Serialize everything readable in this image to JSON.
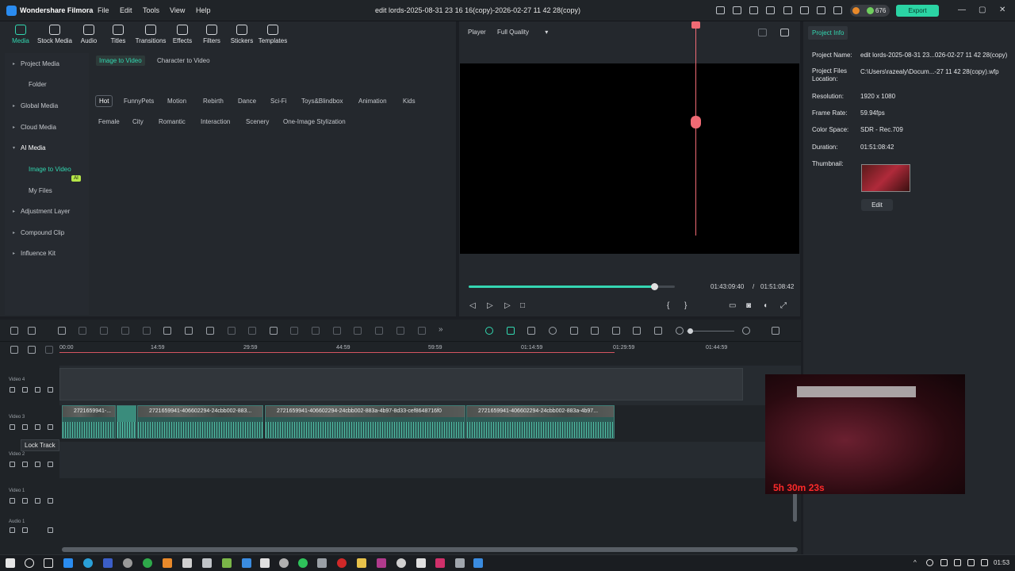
{
  "titlebar": {
    "app_name": "Wondershare Filmora",
    "menu": [
      "File",
      "Edit",
      "Tools",
      "View",
      "Help"
    ],
    "doc_title": "edit lords-2025-08-31 23 16 16(copy)-2026-02-27 11 42 28(copy)",
    "credits": "676",
    "export_label": "Export"
  },
  "toolbar": {
    "items": [
      "Media",
      "Stock Media",
      "Audio",
      "Titles",
      "Transitions",
      "Effects",
      "Filters",
      "Stickers",
      "Templates"
    ]
  },
  "sidebar": {
    "items": [
      "Project Media",
      "Folder",
      "Global Media",
      "Cloud Media",
      "AI Media",
      "Image to Video",
      "My Files",
      "Adjustment Layer",
      "Compound Clip",
      "Influence Kit"
    ],
    "ai_badge": "AI"
  },
  "media": {
    "tabs": [
      "Image to Video",
      "Character to Video"
    ],
    "chips_row1": [
      "Hot",
      "FunnyPets",
      "Motion",
      "Rebirth",
      "Dance",
      "Sci-Fi",
      "Toys&Blindbox",
      "Animation",
      "Kids"
    ],
    "chips_row2": [
      "Female",
      "City",
      "Romantic",
      "Interaction",
      "Scenery",
      "One-Image Stylization"
    ]
  },
  "player": {
    "label": "Player",
    "quality": "Full Quality",
    "current_time": "01:43:09:40",
    "separator": "/",
    "total_time": "01:51:08:42",
    "progress": 0.9
  },
  "project_info": {
    "tab": "Project Info",
    "rows": [
      {
        "k": "Project Name:",
        "v": "edit lords-2025-08-31 23...026-02-27 11 42 28(copy)"
      },
      {
        "k": "Project Files Location:",
        "v": "C:\\Users\\razealy\\Docum...-27 11 42 28(copy).wfp"
      },
      {
        "k": "Resolution:",
        "v": "1920 x 1080"
      },
      {
        "k": "Frame Rate:",
        "v": "59.94fps"
      },
      {
        "k": "Color Space:",
        "v": "SDR - Rec.709"
      },
      {
        "k": "Duration:",
        "v": "01:51:08:42"
      },
      {
        "k": "Thumbnail:",
        "v": ""
      }
    ],
    "edit_label": "Edit"
  },
  "timeline": {
    "ruler": [
      "00:00",
      "14:59",
      "29:59",
      "44:59",
      "59:59",
      "01:14:59",
      "01:29:59",
      "01:44:59"
    ],
    "tracks": [
      "Video 4",
      "Video 3",
      "Video 2",
      "Video 1",
      "Audio 1"
    ],
    "clips": [
      "2721659941-...",
      "2721659941-406602294-24cbb002-883...",
      "2721659941-406602294-24cbb002-883a-4b97-8d33-cef8648716f0",
      "2721659941-406602294-24cbb002-883a-4b97..."
    ],
    "tooltip": "Lock Track"
  },
  "overlay": {
    "timer": "5h 30m 23s"
  },
  "taskbar": {
    "time": "01:53"
  }
}
